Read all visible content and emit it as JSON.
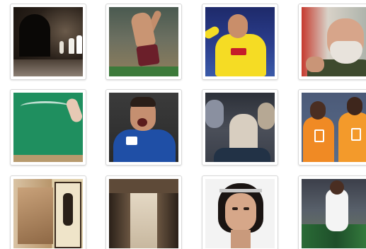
{
  "grid": {
    "tiles": [
      {
        "name": "image-tile-cave-ritual"
      },
      {
        "name": "image-tile-soccer-player-shirtless"
      },
      {
        "name": "image-tile-soccer-player-yellow-kit"
      },
      {
        "name": "image-tile-bearded-man-uniform"
      },
      {
        "name": "image-tile-chalkboard-writing"
      },
      {
        "name": "image-tile-soccer-player-shouting"
      },
      {
        "name": "image-tile-crowd-veiled-woman"
      },
      {
        "name": "image-tile-soccer-players-orange-kit"
      },
      {
        "name": "image-tile-map-and-card"
      },
      {
        "name": "image-tile-long-hallway"
      },
      {
        "name": "image-tile-woman-headband"
      },
      {
        "name": "image-tile-basketball-player"
      }
    ]
  },
  "colors": {
    "tile_border": "#d9d9d9",
    "background": "#ffffff"
  }
}
